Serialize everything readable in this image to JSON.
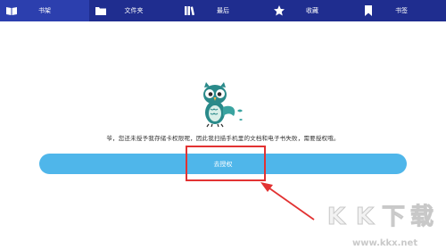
{
  "tabs": [
    {
      "label": "书架",
      "icon": "book-open-icon",
      "active": true
    },
    {
      "label": "文件夹",
      "icon": "folder-icon",
      "active": false
    },
    {
      "label": "最后",
      "icon": "library-icon",
      "active": false
    },
    {
      "label": "收藏",
      "icon": "star-icon",
      "active": false
    },
    {
      "label": "书签",
      "icon": "bookmark-icon",
      "active": false
    }
  ],
  "main": {
    "message": "爷，您还未授予我存储卡权限呢，因此我扫描手机里的文档和电子书失败，需要授权哦。",
    "authorize_label": "去授权"
  },
  "watermark": {
    "logo": "KK下载",
    "url": "www.kkx.net"
  },
  "colors": {
    "tabbar": "#1f2d8f",
    "tab_active": "#2c3fae",
    "button": "#4fb6ea",
    "highlight": "#e23232"
  }
}
